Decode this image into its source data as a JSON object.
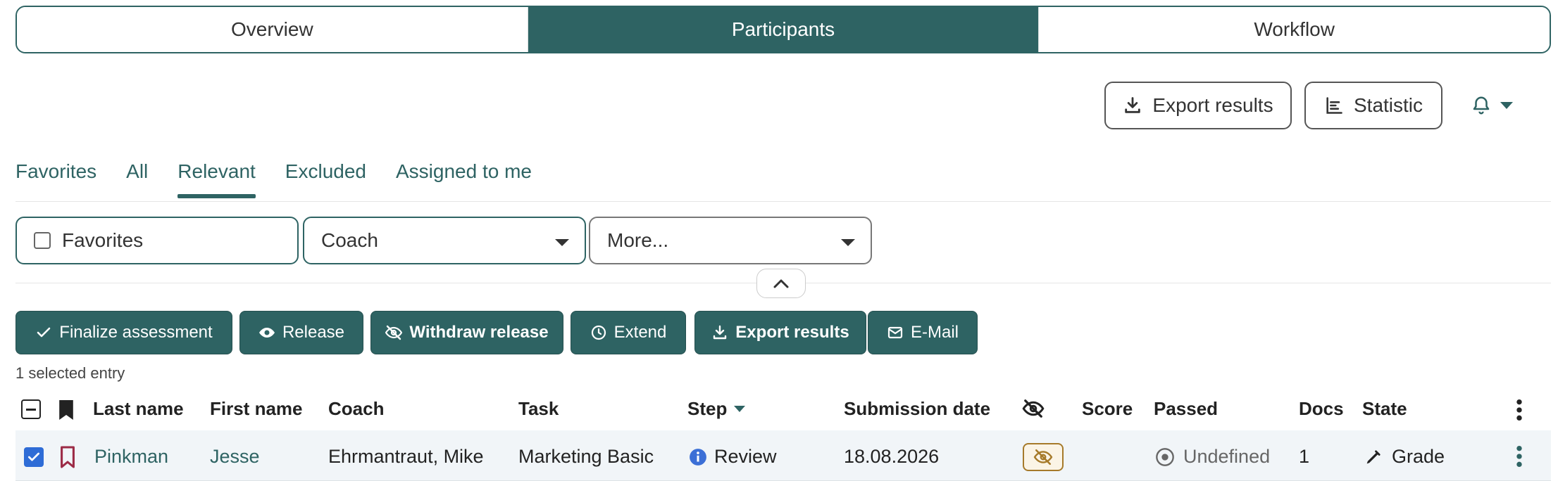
{
  "segments": {
    "overview": "Overview",
    "participants": "Participants",
    "workflow": "Workflow"
  },
  "toolbar": {
    "export_results": "Export results",
    "statistic": "Statistic",
    "notification_icon": "bell-icon"
  },
  "tabs": {
    "favorites": "Favorites",
    "all": "All",
    "relevant": "Relevant",
    "excluded": "Excluded",
    "assigned": "Assigned to me"
  },
  "filters": {
    "favorites": "Favorites",
    "coach": "Coach",
    "more": "More..."
  },
  "actions": {
    "finalize": "Finalize assessment",
    "release": "Release",
    "withdraw": "Withdraw release",
    "extend": "Extend",
    "export": "Export results",
    "email": "E-Mail"
  },
  "selection": {
    "count_text": "1 selected entry"
  },
  "table": {
    "headers": {
      "last_name": "Last name",
      "first_name": "First name",
      "coach": "Coach",
      "task": "Task",
      "step": "Step",
      "submission_date": "Submission date",
      "score": "Score",
      "passed": "Passed",
      "docs": "Docs",
      "state": "State"
    },
    "rows": [
      {
        "last_name": "Pinkman",
        "first_name": "Jesse",
        "coach": "Ehrmantraut, Mike",
        "task": "Marketing Basic",
        "step": "Review",
        "submission_date": "18.08.2026",
        "score": "",
        "passed": "Undefined",
        "docs": "1",
        "state": "Grade",
        "selected": true
      }
    ]
  },
  "colors": {
    "accent": "#2e6363",
    "info": "#3b6fd6",
    "bookmark": "#9c2b46",
    "badge": "#a67a2a"
  }
}
